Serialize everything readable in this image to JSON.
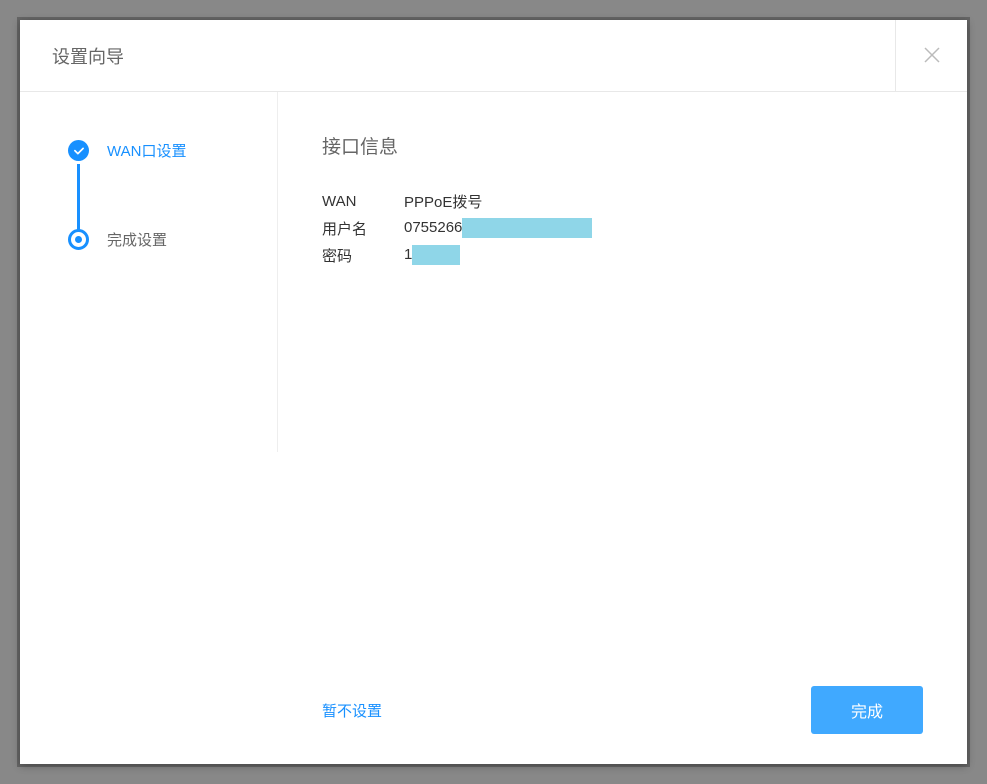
{
  "header": {
    "title": "设置向导"
  },
  "sidebar": {
    "steps": [
      {
        "label": "WAN口设置",
        "state": "complete"
      },
      {
        "label": "完成设置",
        "state": "current"
      }
    ]
  },
  "main": {
    "section_title": "接口信息",
    "rows": [
      {
        "label": "WAN",
        "value": "PPPoE拨号"
      },
      {
        "label": "用户名",
        "value": "0755266"
      },
      {
        "label": "密码",
        "value": "1"
      }
    ]
  },
  "footer": {
    "skip_label": "暂不设置",
    "finish_label": "完成"
  }
}
